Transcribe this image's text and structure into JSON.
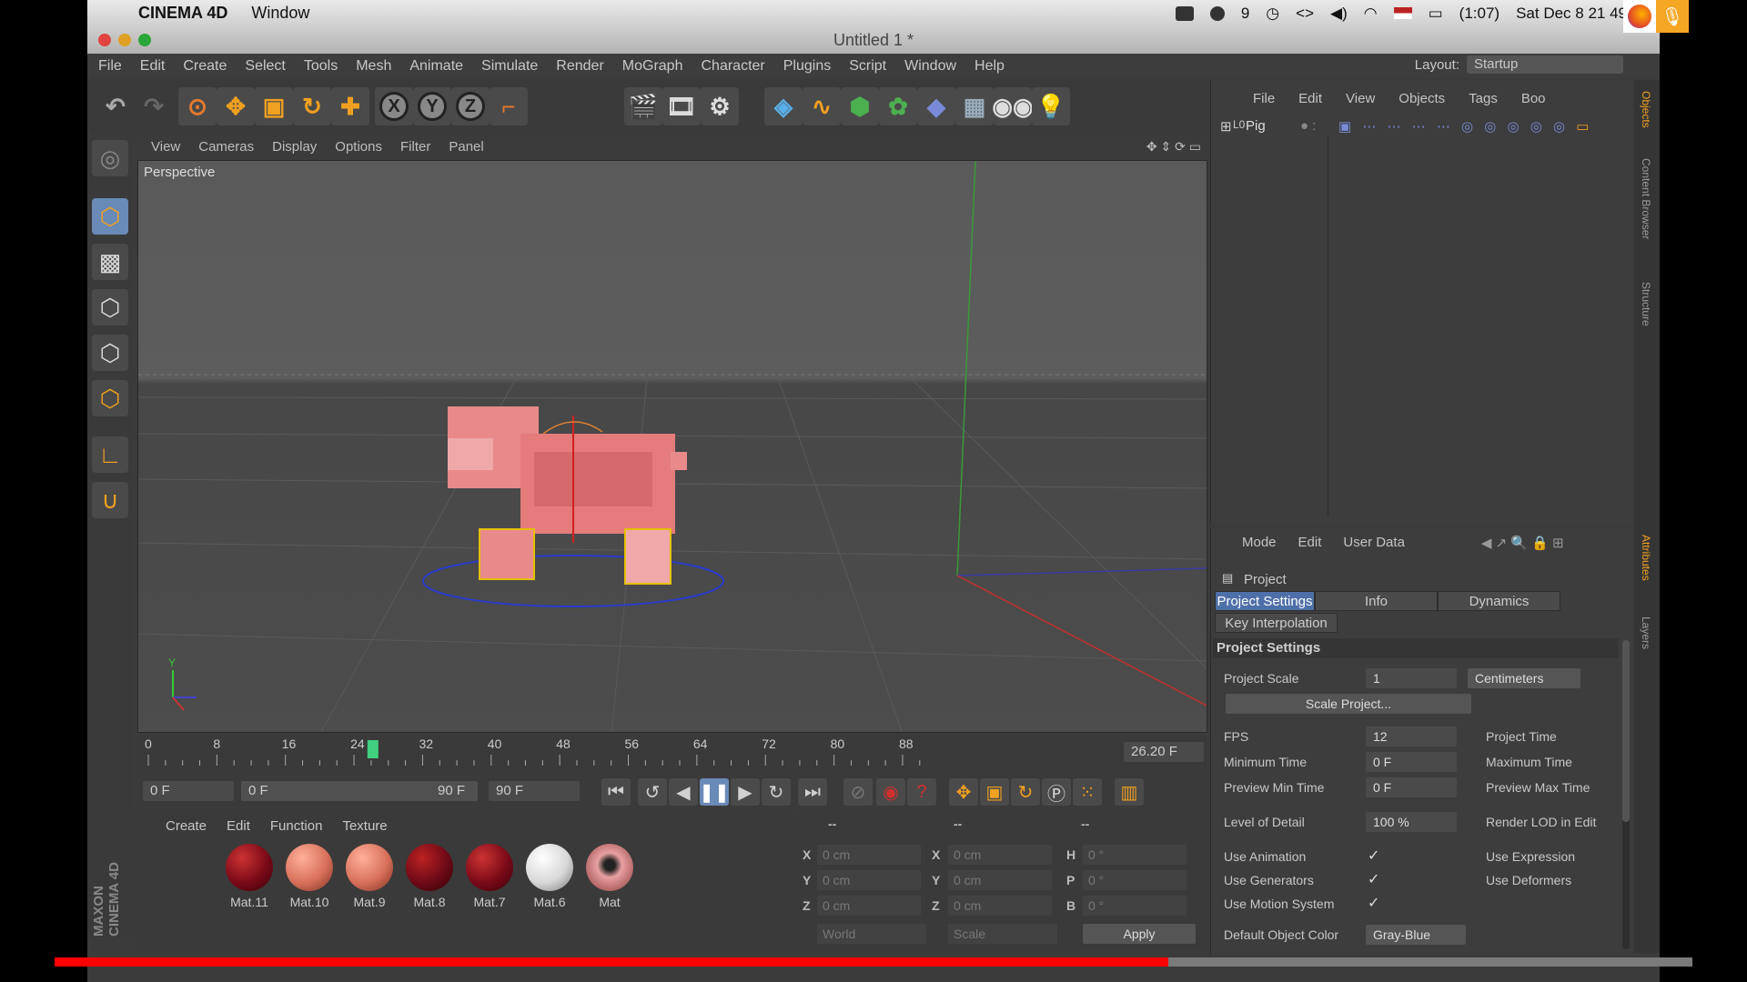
{
  "mac_menubar": {
    "app_name": "CINEMA 4D",
    "menu": "Window",
    "date_time": "Sat Dec 8  21 49",
    "battery": "(1:07)",
    "input_indicator": "9"
  },
  "window": {
    "title": "Untitled 1 *"
  },
  "c4d_menu": [
    "File",
    "Edit",
    "Create",
    "Select",
    "Tools",
    "Mesh",
    "Animate",
    "Simulate",
    "Render",
    "MoGraph",
    "Character",
    "Plugins",
    "Script",
    "Window",
    "Help"
  ],
  "layout": {
    "label": "Layout:",
    "value": "Startup"
  },
  "toolbar": {
    "axis_x": "X",
    "axis_y": "Y",
    "axis_z": "Z"
  },
  "viewport": {
    "menu": [
      "View",
      "Cameras",
      "Display",
      "Options",
      "Filter",
      "Panel"
    ],
    "camera_label": "Perspective",
    "axis_y": "Y"
  },
  "timeline": {
    "ticks": [
      "0",
      "8",
      "16",
      "24",
      "32",
      "40",
      "48",
      "56",
      "64",
      "72",
      "80",
      "88"
    ],
    "current_frame": "26.20 F",
    "playhead_frame": 26.2
  },
  "transport": {
    "start": "0 F",
    "range_start": "0 F",
    "range_end": "90 F",
    "end": "90 F"
  },
  "materials": {
    "menu": [
      "Create",
      "Edit",
      "Function",
      "Texture"
    ],
    "items": [
      {
        "name": "Mat.11",
        "color": "#7a0a18"
      },
      {
        "name": "Mat.10",
        "color": "#d8705a"
      },
      {
        "name": "Mat.9",
        "color": "#d8705a"
      },
      {
        "name": "Mat.8",
        "color": "#6e0a18"
      },
      {
        "name": "Mat.7",
        "color": "#7a0a18"
      },
      {
        "name": "Mat.6",
        "color": "#d8d8d8"
      },
      {
        "name": "Mat",
        "color": "#c77"
      }
    ]
  },
  "coordinates": {
    "headers": [
      "--",
      "--",
      "--"
    ],
    "rows": [
      {
        "l1": "X",
        "v1": "0 cm",
        "l2": "X",
        "v2": "0 cm",
        "l3": "H",
        "v3": "0 °"
      },
      {
        "l1": "Y",
        "v1": "0 cm",
        "l2": "Y",
        "v2": "0 cm",
        "l3": "P",
        "v3": "0 °"
      },
      {
        "l1": "Z",
        "v1": "0 cm",
        "l2": "Z",
        "v2": "0 cm",
        "l3": "B",
        "v3": "0 °"
      }
    ],
    "space": "World",
    "mode": "Scale",
    "apply": "Apply"
  },
  "objects": {
    "menu": [
      "File",
      "Edit",
      "View",
      "Objects",
      "Tags",
      "Boo"
    ],
    "row_name": "Pig"
  },
  "attributes": {
    "menu": [
      "Mode",
      "Edit",
      "User Data"
    ],
    "title": "Project",
    "tabs": [
      "Project Settings",
      "Info",
      "Dynamics",
      "Key Interpolation"
    ],
    "section": "Project Settings",
    "project_scale_label": "Project Scale",
    "project_scale_value": "1",
    "project_scale_unit": "Centimeters",
    "scale_button": "Scale Project...",
    "fps_label": "FPS",
    "fps_value": "12",
    "project_time_label": "Project Time",
    "min_time_label": "Minimum Time",
    "min_time_value": "0 F",
    "max_time_label": "Maximum Time",
    "preview_min_label": "Preview Min Time",
    "preview_min_value": "0 F",
    "preview_max_label": "Preview Max Time",
    "lod_label": "Level of Detail",
    "lod_value": "100 %",
    "render_lod_label": "Render LOD in Edit",
    "use_animation_label": "Use Animation",
    "use_expression_label": "Use Expression",
    "use_generators_label": "Use Generators",
    "use_deformers_label": "Use Deformers",
    "use_motion_label": "Use Motion System",
    "default_color_label": "Default Object Color",
    "default_color_value": "Gray-Blue",
    "check": "✓"
  },
  "side_tabs": [
    "Objects",
    "Content Browser",
    "Structure",
    "Attributes",
    "Layers"
  ],
  "video_progress": 0.68,
  "brand": "MAXON CINEMA 4D"
}
